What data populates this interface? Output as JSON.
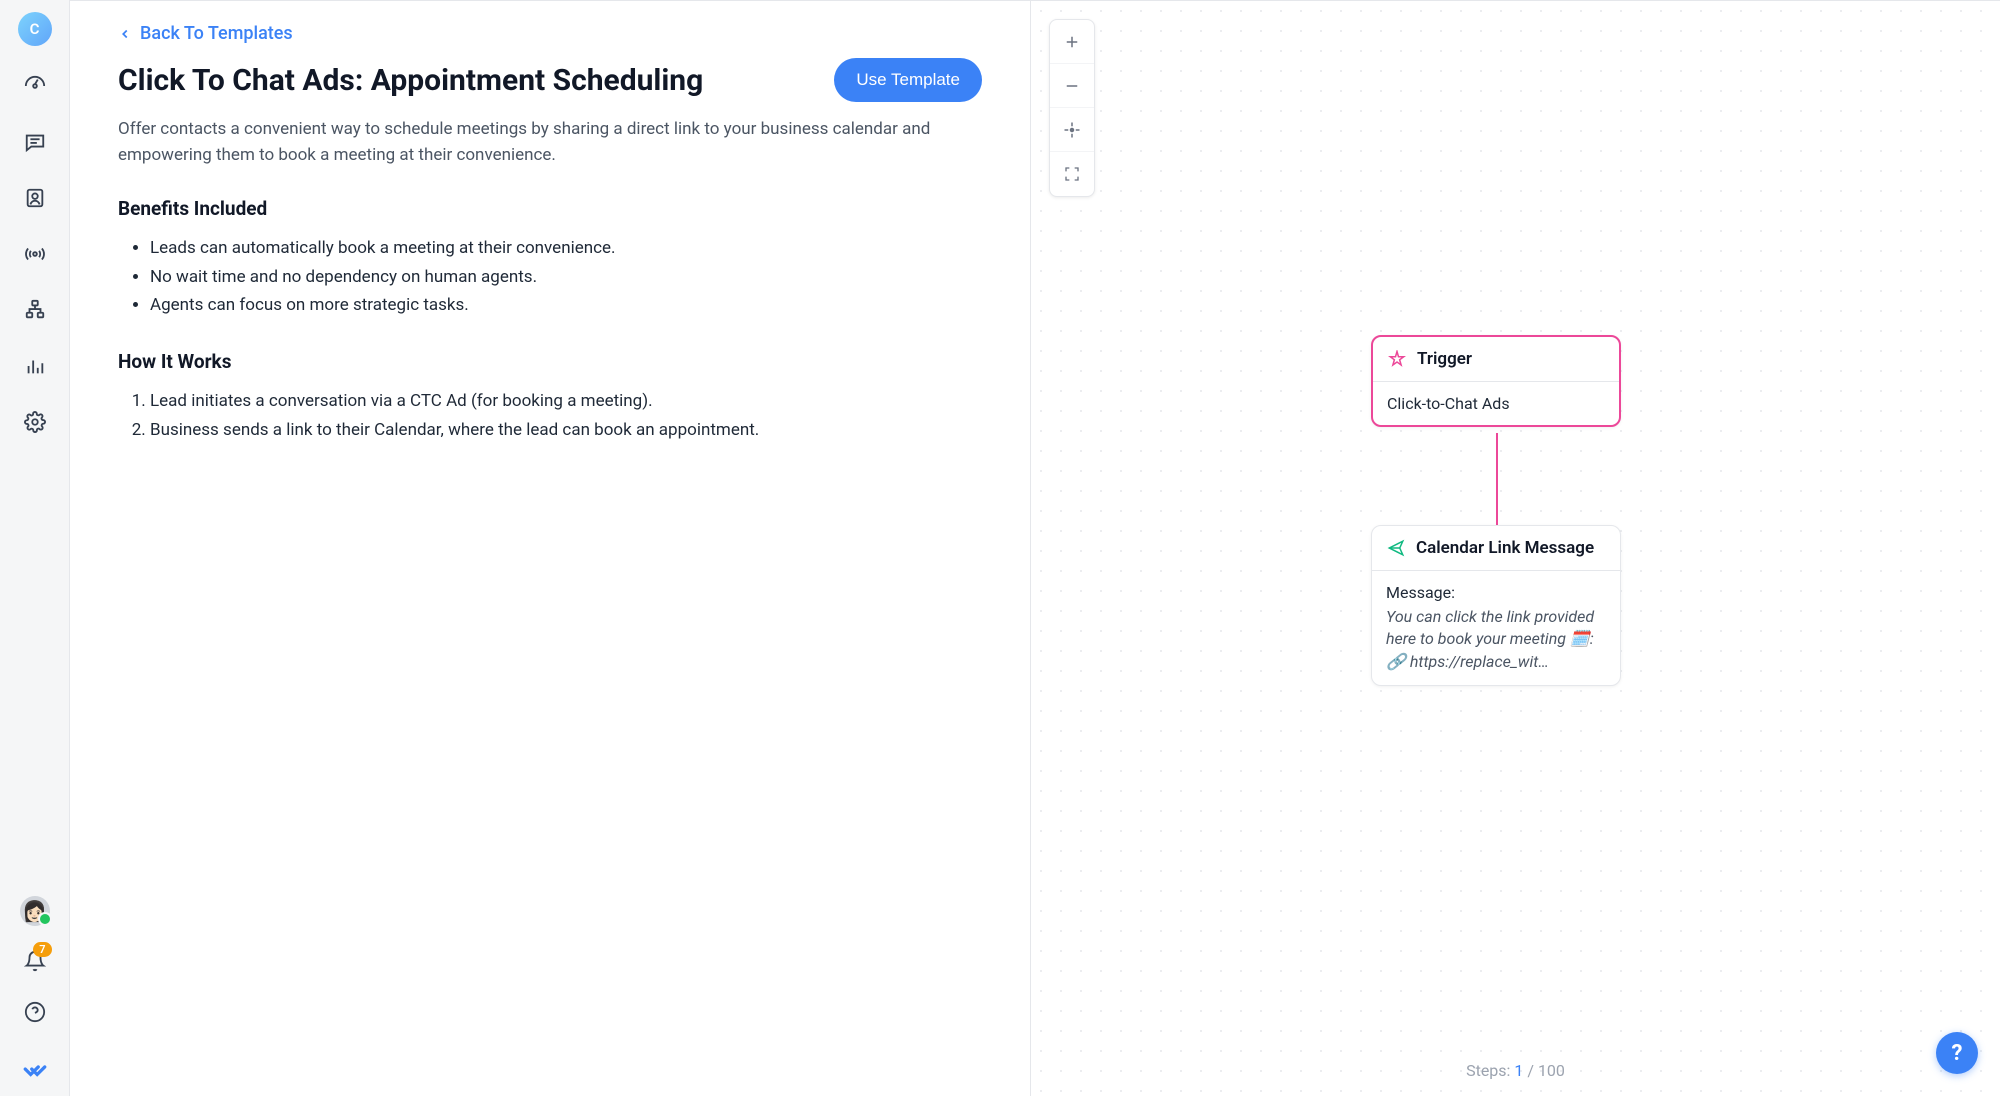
{
  "sidebar": {
    "avatar_letter": "C",
    "notification_count": "7"
  },
  "header": {
    "back_label": "Back To Templates",
    "title": "Click To Chat Ads: Appointment Scheduling",
    "use_button": "Use Template"
  },
  "description": "Offer contacts a convenient way to schedule meetings by sharing a direct link to your business calendar and empowering them to book a meeting at their convenience.",
  "benefits": {
    "heading": "Benefits Included",
    "items": [
      "Leads can automatically book a meeting at their convenience.",
      "No wait time and no dependency on human agents.",
      "Agents can focus on more strategic tasks."
    ]
  },
  "how": {
    "heading": "How It Works",
    "items": [
      "Lead initiates a conversation via a CTC Ad (for booking a meeting).",
      "Business sends a link to their Calendar, where the lead can book an appointment."
    ]
  },
  "canvas": {
    "trigger": {
      "title": "Trigger",
      "body": "Click-to-Chat Ads"
    },
    "action": {
      "title": "Calendar Link Message",
      "msg_label": "Message:",
      "msg_text": "You can click the link provided here to book your meeting 🗓️: 🔗 https://replace_wit…"
    },
    "steps_label": "Steps:",
    "steps_current": "1",
    "steps_sep": " / ",
    "steps_total": "100"
  },
  "help": "?"
}
